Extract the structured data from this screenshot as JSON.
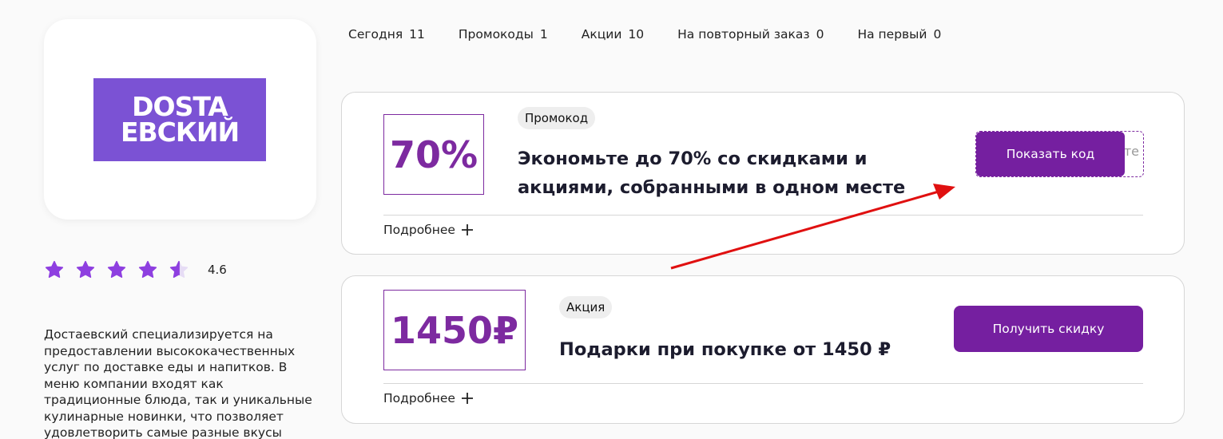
{
  "store": {
    "logo_line1": "DOSTA",
    "logo_line2": "ЕВСКИЙ",
    "rating_value": 4.6,
    "rating_text": "4.6",
    "rating_max": 5,
    "description": "Достаевский специализируется на предоставлении высококачественных услуг по доставке еды и напитков. В меню компании входят как традиционные блюда, так и уникальные кулинарные новинки, что позволяет удовлетворить самые разные вкусы"
  },
  "colors": {
    "accent": "#751fa0",
    "star": "#8e3fe0",
    "logo_bg": "#7b52d4",
    "annotation_arrow": "#e01010"
  },
  "tabs": [
    {
      "label": "Сегодня",
      "count": "11"
    },
    {
      "label": "Промокоды",
      "count": "1"
    },
    {
      "label": "Акции",
      "count": "10"
    },
    {
      "label": "На повторный заказ",
      "count": "0"
    },
    {
      "label": "На первый",
      "count": "0"
    }
  ],
  "offers": [
    {
      "value": "70%",
      "tag": "Промокод",
      "title": "Экономьте до 70% со скидками и акциями, собранными в одном месте",
      "button": "Показать код",
      "code_peek": "те",
      "more": "Подробнее",
      "more_icon": "plus-icon"
    },
    {
      "value": "1450₽",
      "tag": "Акция",
      "title": "Подарки при покупке от 1450 ₽",
      "button": "Получить скидку",
      "more": "Подробнее",
      "more_icon": "plus-icon"
    }
  ],
  "icons": {
    "star": "star-icon",
    "half_star": "half-star-icon",
    "arrow": "annotation-arrow"
  }
}
